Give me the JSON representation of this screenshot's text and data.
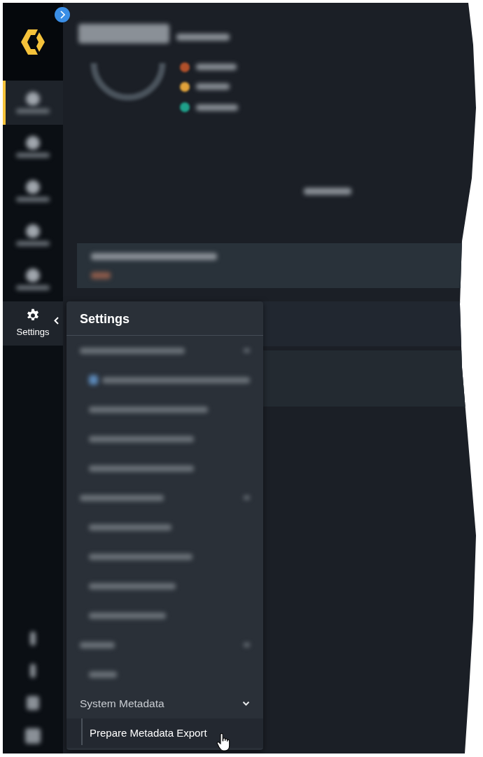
{
  "sidebar": {
    "items": [
      {
        "kind": "blurred",
        "selected": true,
        "open": false
      },
      {
        "kind": "blurred",
        "selected": false,
        "open": false
      },
      {
        "kind": "blurred",
        "selected": false,
        "open": false
      },
      {
        "kind": "blurred",
        "selected": false,
        "open": false
      },
      {
        "kind": "blurred",
        "selected": false,
        "open": false
      },
      {
        "kind": "labeled",
        "label": "Settings",
        "selected": false,
        "open": true
      }
    ]
  },
  "flyout": {
    "title": "Settings",
    "sections": [
      {
        "label": "System Metadata",
        "expanded": true,
        "children": [
          {
            "label": "Prepare Metadata Export",
            "selected": true
          }
        ]
      }
    ]
  }
}
